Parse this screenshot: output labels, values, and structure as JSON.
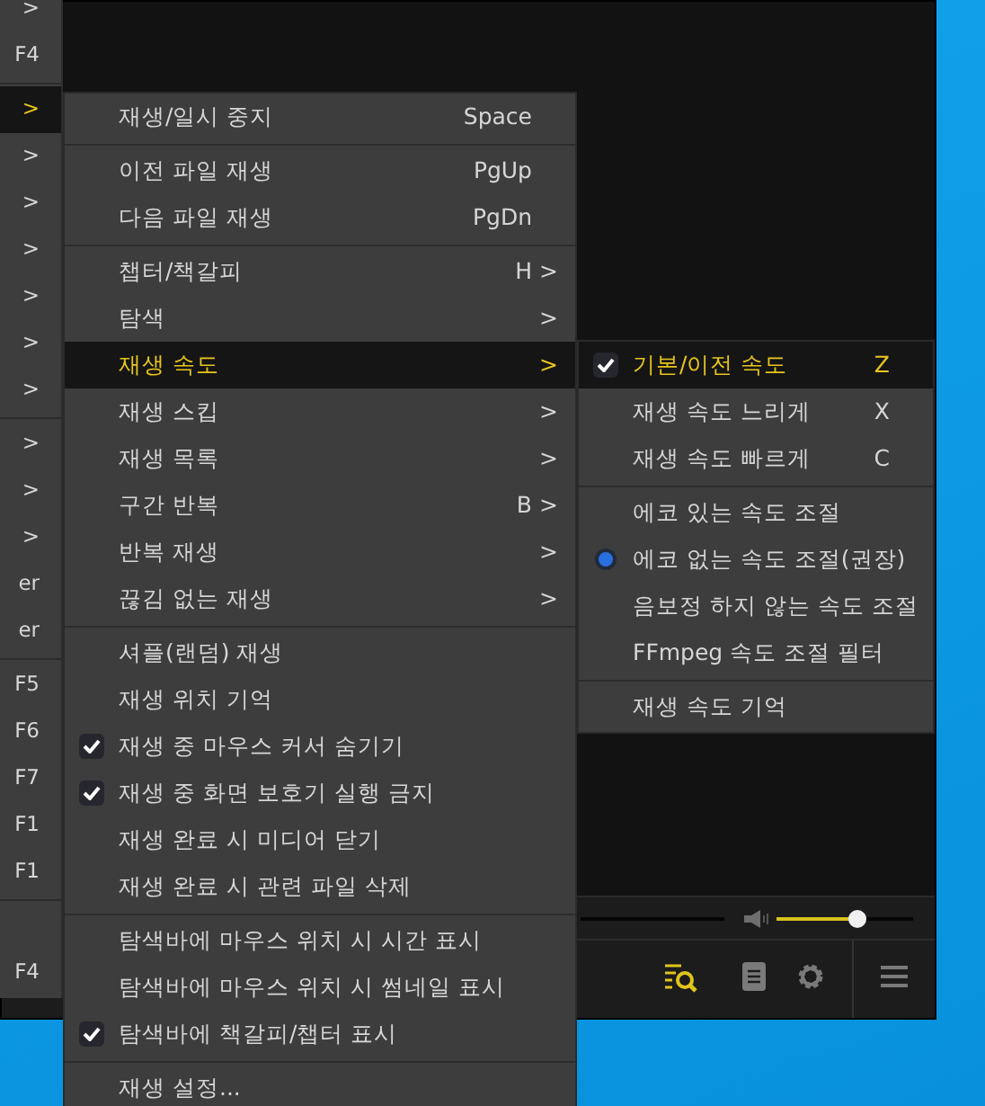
{
  "parent_menu": [
    {
      "kind": "item",
      "shortcut": ">",
      "selected": false
    },
    {
      "kind": "item",
      "shortcut": "F4",
      "selected": false
    },
    {
      "kind": "separator"
    },
    {
      "kind": "item",
      "shortcut": ">",
      "selected": true
    },
    {
      "kind": "item",
      "shortcut": ">",
      "selected": false
    },
    {
      "kind": "item",
      "shortcut": ">",
      "selected": false
    },
    {
      "kind": "item",
      "shortcut": ">",
      "selected": false
    },
    {
      "kind": "item",
      "shortcut": ">",
      "selected": false
    },
    {
      "kind": "item",
      "shortcut": ">",
      "selected": false
    },
    {
      "kind": "item",
      "shortcut": ">",
      "selected": false
    },
    {
      "kind": "separator"
    },
    {
      "kind": "item",
      "shortcut": ">",
      "selected": false
    },
    {
      "kind": "item",
      "shortcut": ">",
      "selected": false
    },
    {
      "kind": "item",
      "shortcut": ">",
      "selected": false
    },
    {
      "kind": "item",
      "shortcut": "er",
      "selected": false
    },
    {
      "kind": "item",
      "shortcut": "er",
      "selected": false
    },
    {
      "kind": "separator"
    },
    {
      "kind": "item",
      "shortcut": "F5",
      "selected": false
    },
    {
      "kind": "item",
      "shortcut": "F6",
      "selected": false
    },
    {
      "kind": "item",
      "shortcut": "F7",
      "selected": false
    },
    {
      "kind": "item",
      "shortcut": "F1",
      "selected": false
    },
    {
      "kind": "item",
      "shortcut": "F1",
      "selected": false
    },
    {
      "kind": "separator"
    },
    {
      "kind": "blank"
    },
    {
      "kind": "item",
      "shortcut": "F4",
      "selected": false
    }
  ],
  "playback_menu": [
    {
      "kind": "check",
      "label": "재생/일시 중지",
      "shortcut": "Space",
      "checked": false,
      "selected": false
    },
    {
      "kind": "separator"
    },
    {
      "kind": "check",
      "label": "이전 파일 재생",
      "shortcut": "PgUp",
      "checked": false,
      "selected": false
    },
    {
      "kind": "check",
      "label": "다음 파일 재생",
      "shortcut": "PgDn",
      "checked": false,
      "selected": false
    },
    {
      "kind": "separator"
    },
    {
      "kind": "check",
      "label": "챕터/책갈피",
      "shortcut": "H",
      "arrow": ">",
      "checked": false,
      "selected": false
    },
    {
      "kind": "check",
      "label": "탐색",
      "arrow": ">",
      "checked": false,
      "selected": false
    },
    {
      "kind": "check",
      "label": "재생 속도",
      "arrow": ">",
      "checked": false,
      "selected": true
    },
    {
      "kind": "check",
      "label": "재생 스킵",
      "arrow": ">",
      "checked": false,
      "selected": false
    },
    {
      "kind": "check",
      "label": "재생 목록",
      "arrow": ">",
      "checked": false,
      "selected": false
    },
    {
      "kind": "check",
      "label": "구간 반복",
      "shortcut": "B",
      "arrow": ">",
      "checked": false,
      "selected": false
    },
    {
      "kind": "check",
      "label": "반복 재생",
      "arrow": ">",
      "checked": false,
      "selected": false
    },
    {
      "kind": "check",
      "label": "끊김 없는 재생",
      "arrow": ">",
      "checked": false,
      "selected": false
    },
    {
      "kind": "separator"
    },
    {
      "kind": "check",
      "label": "셔플(랜덤) 재생",
      "checked": false,
      "selected": false
    },
    {
      "kind": "check",
      "label": "재생 위치 기억",
      "checked": false,
      "selected": false
    },
    {
      "kind": "check",
      "label": "재생 중 마우스 커서 숨기기",
      "checked": true,
      "selected": false
    },
    {
      "kind": "check",
      "label": "재생 중 화면 보호기 실행 금지",
      "checked": true,
      "selected": false
    },
    {
      "kind": "check",
      "label": "재생 완료 시 미디어 닫기",
      "checked": false,
      "selected": false
    },
    {
      "kind": "check",
      "label": "재생 완료 시 관련 파일 삭제",
      "checked": false,
      "selected": false
    },
    {
      "kind": "separator"
    },
    {
      "kind": "check",
      "label": "탐색바에 마우스 위치 시 시간 표시",
      "checked": false,
      "selected": false
    },
    {
      "kind": "check",
      "label": "탐색바에 마우스 위치 시 썸네일 표시",
      "checked": false,
      "selected": false
    },
    {
      "kind": "check",
      "label": "탐색바에 책갈피/챕터 표시",
      "checked": true,
      "selected": false
    },
    {
      "kind": "separator"
    },
    {
      "kind": "check",
      "label": "재생 설정...",
      "checked": false,
      "selected": false
    }
  ],
  "speed_menu": [
    {
      "kind": "check",
      "label": "기본/이전 속도",
      "shortcut": "Z",
      "checked": true,
      "selected": true
    },
    {
      "kind": "check",
      "label": "재생 속도 느리게",
      "shortcut": "X",
      "checked": false,
      "selected": false
    },
    {
      "kind": "check",
      "label": "재생 속도 빠르게",
      "shortcut": "C",
      "checked": false,
      "selected": false
    },
    {
      "kind": "separator"
    },
    {
      "kind": "radio",
      "label": "에코 있는 속도 조절",
      "checked": false,
      "selected": false
    },
    {
      "kind": "radio",
      "label": "에코 없는 속도 조절(권장)",
      "checked": true,
      "selected": false
    },
    {
      "kind": "radio",
      "label": "음보정 하지 않는 속도 조절",
      "checked": false,
      "selected": false
    },
    {
      "kind": "radio",
      "label": "FFmpeg 속도 조절 필터",
      "checked": false,
      "selected": false
    },
    {
      "kind": "separator"
    },
    {
      "kind": "check",
      "label": "재생 속도 기억",
      "checked": false,
      "selected": false
    }
  ],
  "player": {
    "volume": {
      "level": 0.59
    },
    "toolbar": [
      {
        "kind": "search-list",
        "active": true
      },
      {
        "kind": "memo",
        "active": false
      },
      {
        "kind": "gear",
        "active": false
      },
      {
        "kind": "menu",
        "active": false
      }
    ]
  }
}
